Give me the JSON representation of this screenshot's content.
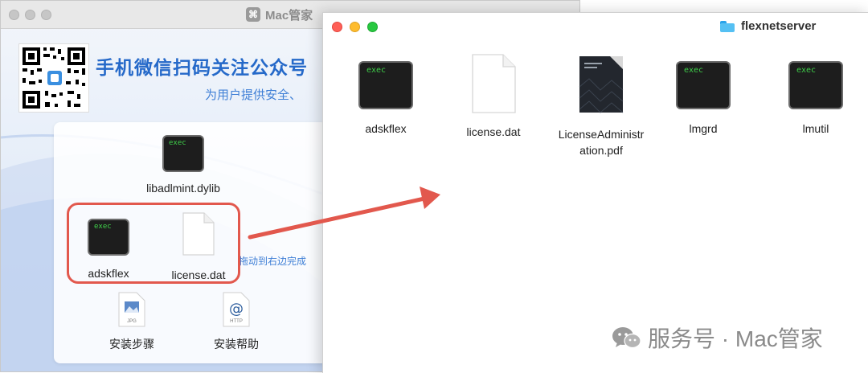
{
  "back_window": {
    "title": "Mac管家",
    "promo_line1": "手机微信扫码关注公众号",
    "promo_line2": "为用户提供安全、",
    "drag_hint": "拖动到右边完成",
    "panel_files": [
      {
        "label": "libadlmint.dylib",
        "icon": "exec-icon",
        "icon_text": "exec"
      },
      {
        "label": "adskflex",
        "icon": "exec-icon",
        "icon_text": "exec"
      },
      {
        "label": "license.dat",
        "icon": "document-icon"
      }
    ],
    "bottom_items": [
      {
        "label": "安装步骤",
        "icon": "jpg-file-icon",
        "icon_text": "JPG"
      },
      {
        "label": "安装帮助",
        "icon": "http-file-icon",
        "icon_text": "HTTP",
        "symbol": "@"
      }
    ],
    "highlight_color": "#e2584d"
  },
  "front_window": {
    "title": "flexnetserver",
    "files": [
      {
        "label": "adskflex",
        "icon": "exec-icon",
        "icon_text": "exec"
      },
      {
        "label": "license.dat",
        "icon": "document-icon"
      },
      {
        "label_line1": "LicenseAdministr",
        "label_line2": "ation.pdf",
        "icon": "pdf-icon"
      },
      {
        "label": "lmgrd",
        "icon": "exec-icon",
        "icon_text": "exec"
      },
      {
        "label": "lmutil",
        "icon": "exec-icon",
        "icon_text": "exec"
      }
    ]
  },
  "watermark": {
    "text": "服务号 · Mac管家",
    "icon": "wechat-icon"
  },
  "colors": {
    "accent_blue": "#2569c9",
    "arrow": "#e2584d",
    "exec_text": "#3fd14a"
  }
}
